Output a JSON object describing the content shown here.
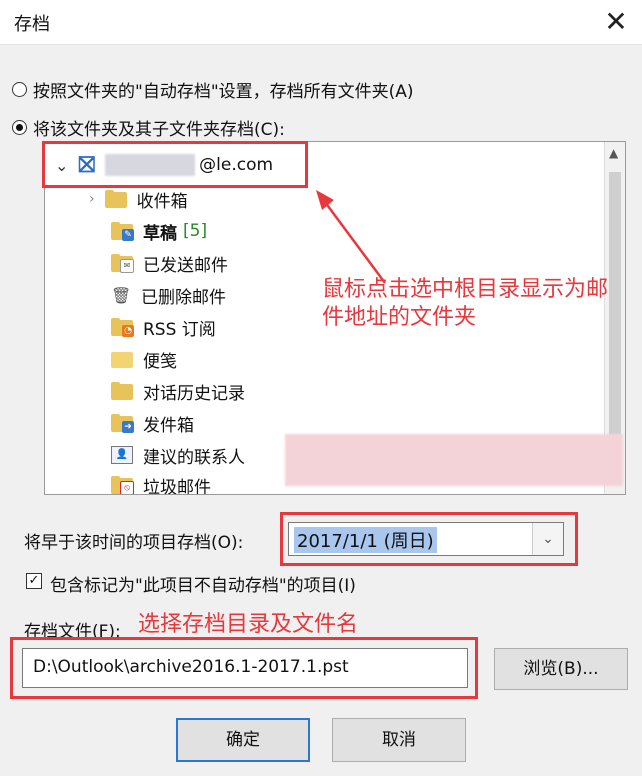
{
  "window": {
    "title": "存档",
    "close_glyph": "✕"
  },
  "options": {
    "auto_archive_label": "按照文件夹的\"自动存档\"设置，存档所有文件夹(A)",
    "folder_archive_label": "将该文件夹及其子文件夹存档(C):"
  },
  "tree": {
    "root_label": "@le.com",
    "items": [
      {
        "label": "收件箱",
        "icon": "inbox-folder-icon"
      },
      {
        "label": "草稿",
        "count": "[5]",
        "icon": "drafts-folder-icon"
      },
      {
        "label": "已发送邮件",
        "icon": "sent-folder-icon"
      },
      {
        "label": "已删除邮件",
        "icon": "trash-icon"
      },
      {
        "label": "RSS 订阅",
        "icon": "rss-folder-icon"
      },
      {
        "label": "便笺",
        "icon": "notes-folder-icon"
      },
      {
        "label": "对话历史记录",
        "icon": "folder-icon"
      },
      {
        "label": "发件箱",
        "icon": "outbox-folder-icon"
      },
      {
        "label": "建议的联系人",
        "icon": "contacts-icon"
      },
      {
        "label": "垃圾邮件",
        "icon": "junk-folder-icon"
      }
    ]
  },
  "annotations": {
    "root_note_line1": "鼠标点击选中根目录显示为邮",
    "root_note_line2": "件地址的文件夹",
    "file_note": "选择存档目录及文件名"
  },
  "date": {
    "label": "将早于该时间的项目存档(O):",
    "value": "2017/1/1 (周日)"
  },
  "include": {
    "label": "包含标记为\"此项目不自动存档\"的项目(I)",
    "checked": true
  },
  "file": {
    "label": "存档文件(F):",
    "value": "D:\\Outlook\\archive2016.1-2017.1.pst",
    "browse_label": "浏览(B)..."
  },
  "buttons": {
    "ok": "确定",
    "cancel": "取消"
  },
  "colors": {
    "annotation": "#e8383d",
    "primary_border": "#2b78d4",
    "selection": "#a9c7ee"
  }
}
